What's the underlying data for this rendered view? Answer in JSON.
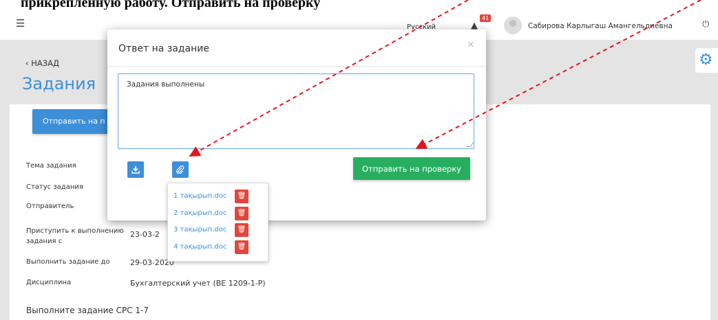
{
  "doc_caption": "прикрепленную работу. Отправить на проверку",
  "topbar": {
    "menu_icon": "hamburger-icon",
    "language": "Русский",
    "notifications_count": "41",
    "user_name": "Сабирова Карлыгаш Амангельдиевна",
    "power_icon": "power-icon"
  },
  "page": {
    "back_label": "‹ НАЗАД",
    "title": "Задания",
    "submit_button_label": "Отправить на п",
    "fields": [
      {
        "label": "Тема задания",
        "value": ""
      },
      {
        "label": "Статус задания",
        "value": ""
      },
      {
        "label": "Отправитель",
        "value": ""
      },
      {
        "label": "Приступить к выполнению задания с",
        "value": "23-03-2"
      },
      {
        "label": "Выполнить задание до",
        "value": "29-03-2020"
      },
      {
        "label": "Дисциплина",
        "value": "Бухгалтерский учет (ВЕ 1209-1-Р)"
      }
    ],
    "task_text": "Выполните задание СРС 1-7"
  },
  "modal": {
    "title": "Ответ на задание",
    "close_label": "×",
    "answer_text": "Задания выполнены",
    "submit_label": "Отправить на проверку"
  },
  "attachments": [
    {
      "name": "1 тақырып.doc"
    },
    {
      "name": "2 тақырып.doc"
    },
    {
      "name": "3 тақырып.doc"
    },
    {
      "name": "4 тақырып.doc"
    }
  ],
  "colors": {
    "accent": "#3d8fd8",
    "success": "#27ae60",
    "danger": "#e2463b",
    "arrow": "#e8141c"
  }
}
